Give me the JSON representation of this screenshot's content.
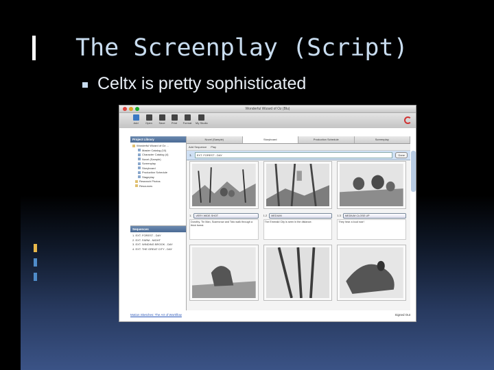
{
  "slide": {
    "title": "The Screenplay (Script)",
    "bullet": "Celtx is pretty sophisticated"
  },
  "app": {
    "window_title": "Wonderful Wizard of Oz (Blu)",
    "toolbar": [
      {
        "label": "Add",
        "icon": "add-icon"
      },
      {
        "label": "Open",
        "icon": "open-icon"
      },
      {
        "label": "Save",
        "icon": "save-icon"
      },
      {
        "label": "Print",
        "icon": "print-icon"
      },
      {
        "label": "Format",
        "icon": "format-icon"
      },
      {
        "label": "My Studio",
        "icon": "studio-icon"
      }
    ],
    "project_library": {
      "title": "Project Library",
      "items": [
        {
          "label": "Wonderful Wizard of Oz ..."
        },
        {
          "label": "Master Catalog (10)"
        },
        {
          "label": "Character Catalog (4)"
        },
        {
          "label": "Novel (Sample)"
        },
        {
          "label": "Screenplay"
        },
        {
          "label": "Storyboard"
        },
        {
          "label": "Production Schedule"
        },
        {
          "label": "Stageplay"
        },
        {
          "label": "Research Photos"
        },
        {
          "label": "Resources"
        }
      ]
    },
    "sequences": {
      "title": "Sequences",
      "items": [
        {
          "label": "1. EXT. FOREST - DAY"
        },
        {
          "label": "2. EXT. FARM - NIGHT"
        },
        {
          "label": "3. EXT. WINDING BROOK - DAY"
        },
        {
          "label": "4. EXT. THE GREAT CITY - DAY"
        }
      ]
    },
    "tabs": [
      {
        "label": "Novel (Sample)"
      },
      {
        "label": "Storyboard"
      },
      {
        "label": "Production Schedule"
      },
      {
        "label": "Screenplay"
      }
    ],
    "subbar": {
      "add_sequence": "Add Sequence",
      "play": "Play"
    },
    "scene": {
      "number": "1.",
      "heading": "EXT. FOREST - DAY",
      "done": "Done"
    },
    "shots": [
      {
        "number": "1.",
        "type": "VERY WIDE SHOT",
        "desc": "Dorothy, Tin Man, Scarecrow and Toto walk through a thick forest."
      },
      {
        "number": "1.2",
        "type": "MEDIUM",
        "desc": "The Emerald City is seen in the distance."
      },
      {
        "number": "1.3",
        "type": "MEDIUM CLOSE UP",
        "desc": "They hear a loud roar!"
      }
    ],
    "status": {
      "link": "Motion Sketches: The Art of Workflow",
      "right": "Signed Out"
    }
  }
}
